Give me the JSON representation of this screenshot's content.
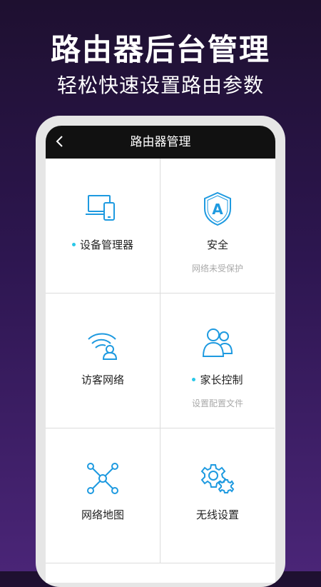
{
  "promo": {
    "headline": "路由器后台管理",
    "subline": "轻松快速设置路由参数"
  },
  "app": {
    "title": "路由器管理",
    "accent_color": "#1e9ae0",
    "dot_color": "#29c7e8",
    "tiles": [
      {
        "label": "设备管理器",
        "sub": "",
        "icon": "devices-icon",
        "dot": true
      },
      {
        "label": "安全",
        "sub": "网络未受保护",
        "icon": "shield-icon",
        "dot": false
      },
      {
        "label": "访客网络",
        "sub": "",
        "icon": "guest-wifi-icon",
        "dot": false
      },
      {
        "label": "家长控制",
        "sub": "设置配置文件",
        "icon": "parental-users-icon",
        "dot": true
      },
      {
        "label": "网络地图",
        "sub": "",
        "icon": "network-map-icon",
        "dot": false
      },
      {
        "label": "无线设置",
        "sub": "",
        "icon": "gear-icon",
        "dot": false
      }
    ]
  }
}
